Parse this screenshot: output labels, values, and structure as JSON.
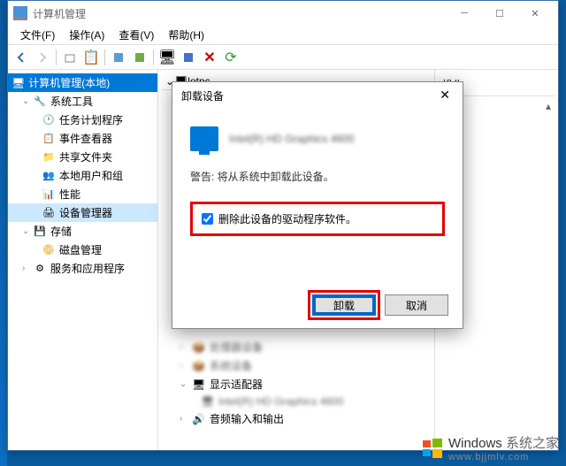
{
  "window": {
    "title": "计算机管理"
  },
  "menubar": {
    "file": "文件(F)",
    "action": "操作(A)",
    "view": "查看(V)",
    "help": "帮助(H)"
  },
  "tree": {
    "root": "计算机管理(本地)",
    "groups": {
      "system_tools": "系统工具",
      "storage": "存储",
      "services": "服务和应用程序"
    },
    "items": {
      "task_scheduler": "任务计划程序",
      "event_viewer": "事件查看器",
      "shared_folders": "共享文件夹",
      "local_users": "本地用户和组",
      "performance": "性能",
      "device_manager": "设备管理器",
      "disk_mgmt": "磁盘管理"
    }
  },
  "device_area": {
    "root": "lotpc",
    "display_adapters": "显示适配器",
    "graphics": "Intel(R) HD Graphics 4600",
    "audio": "音频输入和输出"
  },
  "actions_panel": {
    "header": "操作"
  },
  "dialog": {
    "title": "卸载设备",
    "device_name": "Intel(R) HD Graphics 4600",
    "warning": "警告: 将从系统中卸载此设备。",
    "checkbox_label": "删除此设备的驱动程序软件。",
    "uninstall": "卸载",
    "cancel": "取消"
  },
  "watermark": {
    "brand": "Windows",
    "suffix": "系统之家",
    "url": "www.bjjmlv.com"
  }
}
